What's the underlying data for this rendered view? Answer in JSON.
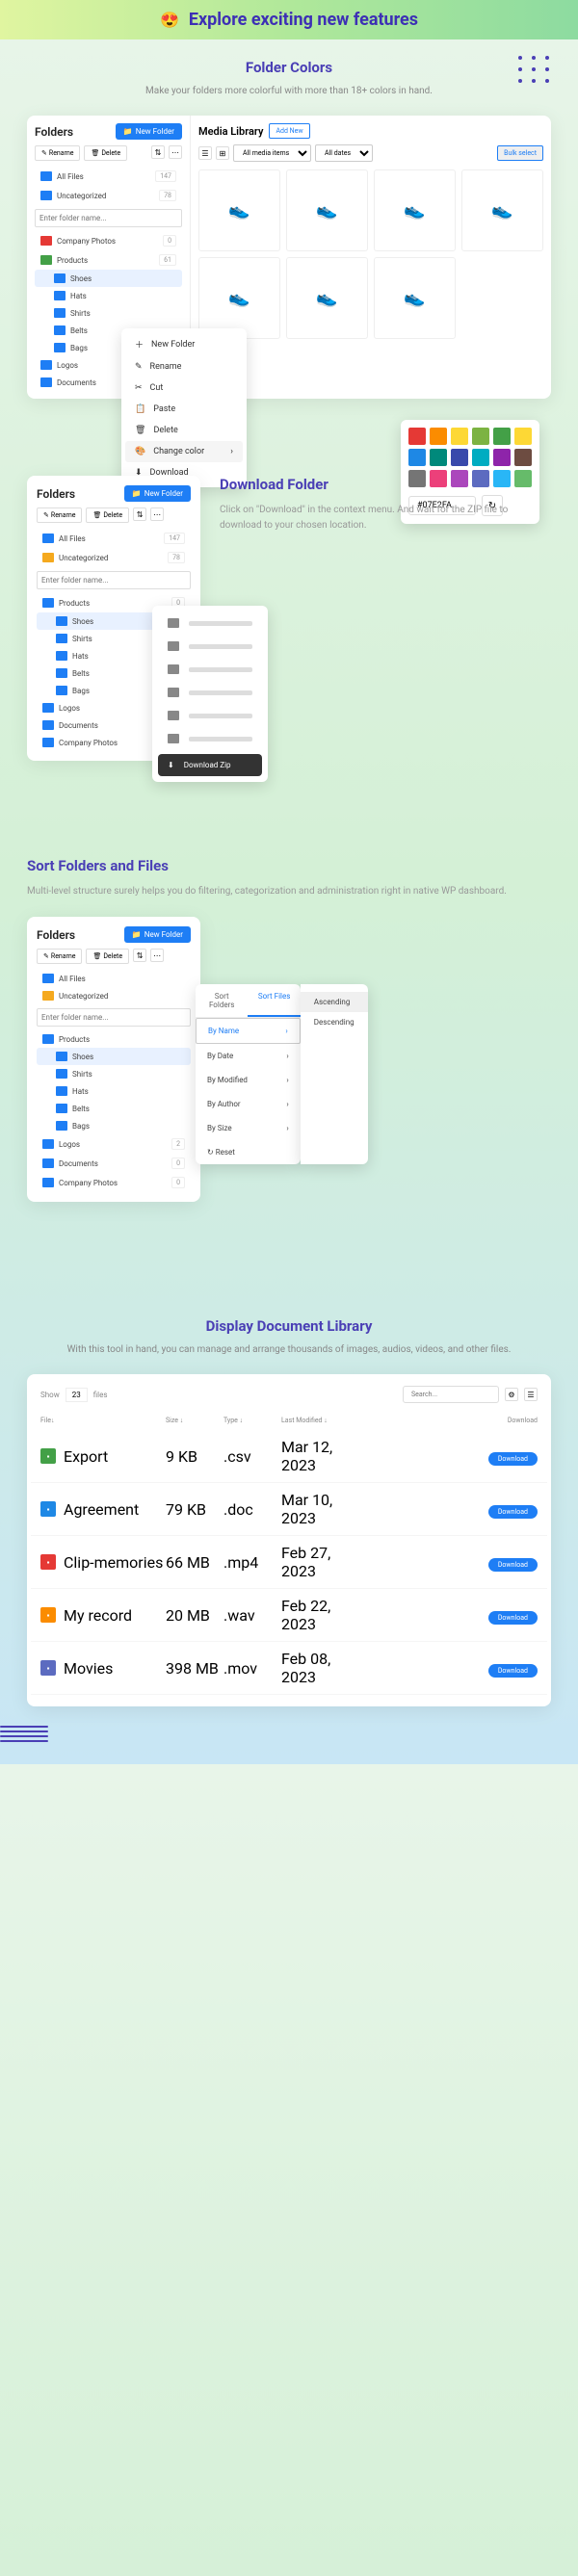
{
  "hero": {
    "emoji": "😍",
    "title": "Explore exciting new features"
  },
  "s1": {
    "title": "Folder Colors",
    "sub": "Make your folders more colorful with more than 18+ colors in hand.",
    "sidebar_title": "Folders",
    "new_folder": "New Folder",
    "rename": "Rename",
    "delete": "Delete",
    "folders": [
      {
        "name": "All Files",
        "count": "147"
      },
      {
        "name": "Uncategorized",
        "count": "78"
      }
    ],
    "input_ph": "Enter folder name...",
    "tree": [
      {
        "name": "Company Photos",
        "count": "0",
        "color": "fi-red"
      },
      {
        "name": "Products",
        "count": "61",
        "color": "fi-green"
      },
      {
        "name": "Shoes",
        "indent": 1,
        "active": true
      },
      {
        "name": "Hats",
        "indent": 1
      },
      {
        "name": "Shirts",
        "indent": 1
      },
      {
        "name": "Belts",
        "indent": 1
      },
      {
        "name": "Bags",
        "indent": 1
      },
      {
        "name": "Logos"
      },
      {
        "name": "Documents"
      }
    ],
    "media_title": "Media Library",
    "add_new": "Add New",
    "filter1": "All media items",
    "filter2": "All dates",
    "bulk": "Bulk select",
    "ctx": [
      "New Folder",
      "Rename",
      "Cut",
      "Paste",
      "Delete",
      "Change color",
      "Download"
    ],
    "colors": [
      "#e53935",
      "#fb8c00",
      "#fdd835",
      "#7cb342",
      "#43a047",
      "#fdd835",
      "#1e88e5",
      "#00897b",
      "#3949ab",
      "#00acc1",
      "#8e24aa",
      "#6d4c41",
      "#757575",
      "#ec407a",
      "#ab47bc",
      "#5c6bc0",
      "#29b6f6",
      "#66bb6a"
    ],
    "hex": "#07E2FA"
  },
  "s2": {
    "title": "Download Folder",
    "desc": "Click on \"Download\" in the context menu. And wait for the ZIP file to download to your chosen location.",
    "sidebar_title": "Folders",
    "new_folder": "New Folder",
    "rename": "Rename",
    "delete": "Delete",
    "folders": [
      {
        "name": "All Files",
        "count": "147"
      },
      {
        "name": "Uncategorized",
        "count": "78"
      }
    ],
    "input_ph": "Enter folder name...",
    "tree": [
      {
        "name": "Products",
        "count": "0"
      },
      {
        "name": "Shoes",
        "indent": 1,
        "active": true
      },
      {
        "name": "Shirts",
        "indent": 1
      },
      {
        "name": "Hats",
        "indent": 1
      },
      {
        "name": "Belts",
        "indent": 1
      },
      {
        "name": "Bags",
        "indent": 1
      },
      {
        "name": "Logos"
      },
      {
        "name": "Documents"
      },
      {
        "name": "Company Photos"
      }
    ],
    "download_zip": "Download Zip"
  },
  "s3": {
    "title": "Sort Folders and Files",
    "sub": "Multi-level structure surely helps you do filtering, categorization and administration right in native WP dashboard.",
    "sidebar_title": "Folders",
    "new_folder": "New Folder",
    "rename": "Rename",
    "delete": "Delete",
    "folders": [
      {
        "name": "All Files"
      },
      {
        "name": "Uncategorized"
      }
    ],
    "input_ph": "Enter folder name...",
    "tree": [
      {
        "name": "Products"
      },
      {
        "name": "Shoes",
        "indent": 1,
        "active": true
      },
      {
        "name": "Shirts",
        "indent": 1
      },
      {
        "name": "Hats",
        "indent": 1
      },
      {
        "name": "Belts",
        "indent": 1
      },
      {
        "name": "Bags",
        "indent": 1
      },
      {
        "name": "Logos",
        "count": "2"
      },
      {
        "name": "Documents",
        "count": "0"
      },
      {
        "name": "Company Photos",
        "count": "0"
      }
    ],
    "tabs": [
      "Sort Folders",
      "Sort Files"
    ],
    "sort_opts": [
      "By Name",
      "By Date",
      "By Modified",
      "By Author",
      "By Size"
    ],
    "reset": "Reset",
    "order": [
      "Ascending",
      "Descending"
    ]
  },
  "s4": {
    "title": "Display Document Library",
    "sub": "With this tool in hand, you can manage and arrange thousands of images, audios, videos, and other files.",
    "show": "Show",
    "show_n": "23",
    "files": "files",
    "search_ph": "Search...",
    "cols": [
      "File",
      "Size",
      "Type",
      "Last Modified",
      "Download"
    ],
    "rows": [
      {
        "ico": "#43a047",
        "name": "Export",
        "size": "9 KB",
        "type": ".csv",
        "date": "Mar 12, 2023"
      },
      {
        "ico": "#1e88e5",
        "name": "Agreement",
        "size": "79 KB",
        "type": ".doc",
        "date": "Mar 10, 2023"
      },
      {
        "ico": "#e53935",
        "name": "Clip-memories",
        "size": "66 MB",
        "type": ".mp4",
        "date": "Feb 27, 2023"
      },
      {
        "ico": "#fb8c00",
        "name": "My record",
        "size": "20 MB",
        "type": ".wav",
        "date": "Feb 22, 2023"
      },
      {
        "ico": "#5c6bc0",
        "name": "Movies",
        "size": "398 MB",
        "type": ".mov",
        "date": "Feb 08, 2023"
      }
    ],
    "download": "Download"
  }
}
